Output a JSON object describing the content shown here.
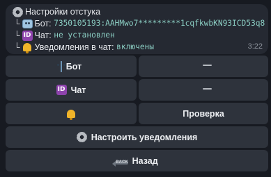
{
  "message": {
    "title": "Настройки отстука",
    "tree_glyph": "└",
    "bot_label": "Бот:",
    "bot_token": "7350105193:AAHMwo7*********1cqfkwbKN93ICD53q8",
    "chat_label": "Чат:",
    "chat_value": "не установлен",
    "notify_label": "Уведомления в чат:",
    "notify_value": "включены",
    "time": "3:22"
  },
  "keyboard": {
    "bot_label": "Бот",
    "chat_label": "Чат",
    "check_label": "Проверка",
    "configure_label": "Настроить уведомления",
    "back_label": "Назад",
    "back_icon_text": "BACK"
  },
  "icons": {
    "gear": "gear-icon",
    "robot": "robot-icon",
    "id": "id-badge-icon",
    "bell": "bell-icon",
    "trash": "trash-icon",
    "back": "back-arrow-icon"
  },
  "colors": {
    "background": "#171a21",
    "bubble": "#252932",
    "button": "#2e333c",
    "mono_text": "#8ccfc4"
  }
}
